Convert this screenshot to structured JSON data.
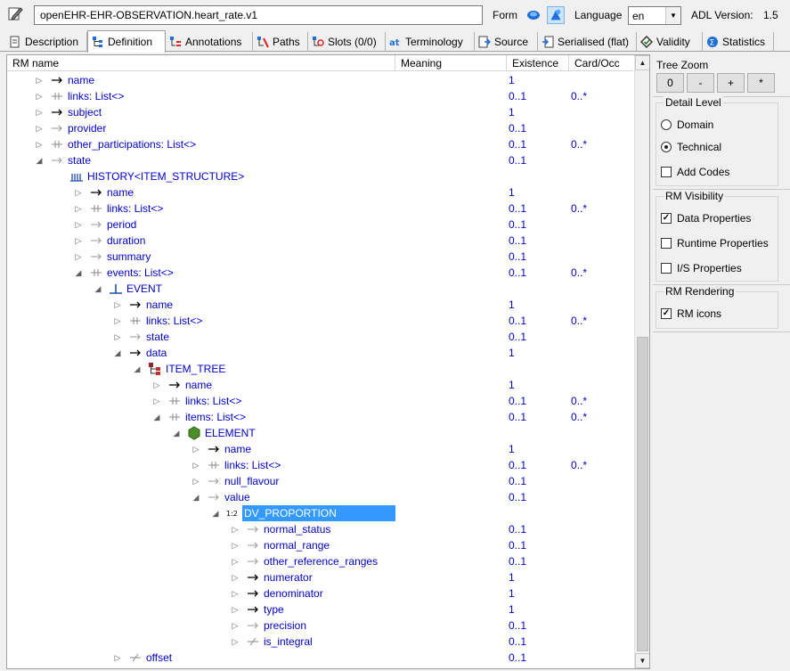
{
  "toolbar": {
    "archetype_id": "openEHR-EHR-OBSERVATION.heart_rate.v1",
    "form_label": "Form",
    "language_label": "Language",
    "language_value": "en",
    "adl_version_label": "ADL Version:",
    "adl_version_value": "1.5"
  },
  "tabs": [
    {
      "label": "Description",
      "icon": "description-icon",
      "active": false
    },
    {
      "label": "Definition",
      "icon": "definition-icon",
      "active": true
    },
    {
      "label": "Annotations",
      "icon": "annotations-icon",
      "active": false
    },
    {
      "label": "Paths",
      "icon": "paths-icon",
      "active": false
    },
    {
      "label": "Slots (0/0)",
      "icon": "slots-icon",
      "active": false
    },
    {
      "label": "Terminology",
      "icon": "terminology-icon",
      "active": false
    },
    {
      "label": "Source",
      "icon": "source-icon",
      "active": false
    },
    {
      "label": "Serialised (flat)",
      "icon": "serialised-icon",
      "active": false
    },
    {
      "label": "Validity",
      "icon": "validity-icon",
      "active": false
    },
    {
      "label": "Statistics",
      "icon": "statistics-icon",
      "active": false
    }
  ],
  "tree": {
    "columns": [
      "RM name",
      "Meaning",
      "Existence",
      "Card/Occ"
    ],
    "rows": [
      {
        "name": "name",
        "level": 0,
        "icon": "single-attr-icon",
        "toggle": "collapsed",
        "existence": "1",
        "card": ""
      },
      {
        "name": "links: List<>",
        "level": 0,
        "icon": "multi-attr-icon",
        "toggle": "collapsed",
        "existence": "0..1",
        "card": "0..*"
      },
      {
        "name": "subject",
        "level": 0,
        "icon": "single-attr-icon",
        "toggle": "collapsed",
        "existence": "1",
        "card": ""
      },
      {
        "name": "provider",
        "level": 0,
        "icon": "optional-attr-icon",
        "toggle": "collapsed",
        "existence": "0..1",
        "card": ""
      },
      {
        "name": "other_participations: List<>",
        "level": 0,
        "icon": "multi-attr-icon",
        "toggle": "collapsed",
        "existence": "0..1",
        "card": "0..*"
      },
      {
        "name": "state",
        "level": 0,
        "icon": "optional-attr-icon",
        "toggle": "expanded",
        "existence": "0..1",
        "card": ""
      },
      {
        "name": "HISTORY<ITEM_STRUCTURE>",
        "level": 1,
        "icon": "history-icon",
        "toggle": "none",
        "existence": "",
        "card": ""
      },
      {
        "name": "name",
        "level": 2,
        "icon": "single-attr-icon",
        "toggle": "collapsed",
        "existence": "1",
        "card": ""
      },
      {
        "name": "links: List<>",
        "level": 2,
        "icon": "multi-attr-icon",
        "toggle": "collapsed",
        "existence": "0..1",
        "card": "0..*"
      },
      {
        "name": "period",
        "level": 2,
        "icon": "optional-attr-icon",
        "toggle": "collapsed",
        "existence": "0..1",
        "card": ""
      },
      {
        "name": "duration",
        "level": 2,
        "icon": "optional-attr-icon",
        "toggle": "collapsed",
        "existence": "0..1",
        "card": ""
      },
      {
        "name": "summary",
        "level": 2,
        "icon": "optional-attr-icon",
        "toggle": "collapsed",
        "existence": "0..1",
        "card": ""
      },
      {
        "name": "events: List<>",
        "level": 2,
        "icon": "multi-attr-icon",
        "toggle": "expanded",
        "existence": "0..1",
        "card": "0..*"
      },
      {
        "name": "EVENT",
        "level": 3,
        "icon": "event-icon",
        "toggle": "expanded",
        "existence": "",
        "card": ""
      },
      {
        "name": "name",
        "level": 4,
        "icon": "single-attr-icon",
        "toggle": "collapsed",
        "existence": "1",
        "card": ""
      },
      {
        "name": "links: List<>",
        "level": 4,
        "icon": "multi-attr-icon",
        "toggle": "collapsed",
        "existence": "0..1",
        "card": "0..*"
      },
      {
        "name": "state",
        "level": 4,
        "icon": "optional-attr-icon",
        "toggle": "collapsed",
        "existence": "0..1",
        "card": ""
      },
      {
        "name": "data",
        "level": 4,
        "icon": "single-attr-icon",
        "toggle": "expanded",
        "existence": "1",
        "card": ""
      },
      {
        "name": "ITEM_TREE",
        "level": 5,
        "icon": "item-tree-icon",
        "toggle": "expanded",
        "existence": "",
        "card": ""
      },
      {
        "name": "name",
        "level": 6,
        "icon": "single-attr-icon",
        "toggle": "collapsed",
        "existence": "1",
        "card": ""
      },
      {
        "name": "links: List<>",
        "level": 6,
        "icon": "multi-attr-icon",
        "toggle": "collapsed",
        "existence": "0..1",
        "card": "0..*"
      },
      {
        "name": "items: List<>",
        "level": 6,
        "icon": "multi-attr-icon",
        "toggle": "expanded",
        "existence": "0..1",
        "card": "0..*"
      },
      {
        "name": "ELEMENT",
        "level": 7,
        "icon": "element-icon",
        "toggle": "expanded",
        "existence": "",
        "card": ""
      },
      {
        "name": "name",
        "level": 8,
        "icon": "single-attr-icon",
        "toggle": "collapsed",
        "existence": "1",
        "card": ""
      },
      {
        "name": "links: List<>",
        "level": 8,
        "icon": "multi-attr-icon",
        "toggle": "collapsed",
        "existence": "0..1",
        "card": "0..*"
      },
      {
        "name": "null_flavour",
        "level": 8,
        "icon": "optional-attr-icon",
        "toggle": "collapsed",
        "existence": "0..1",
        "card": ""
      },
      {
        "name": "value",
        "level": 8,
        "icon": "optional-attr-icon",
        "toggle": "expanded",
        "existence": "0..1",
        "card": ""
      },
      {
        "name": "DV_PROPORTION",
        "level": 9,
        "icon": "proportion-icon",
        "toggle": "expanded",
        "existence": "",
        "card": "",
        "selected": true
      },
      {
        "name": "normal_status",
        "level": 10,
        "icon": "optional-attr-icon",
        "toggle": "collapsed",
        "existence": "0..1",
        "card": ""
      },
      {
        "name": "normal_range",
        "level": 10,
        "icon": "optional-attr-icon",
        "toggle": "collapsed",
        "existence": "0..1",
        "card": ""
      },
      {
        "name": "other_reference_ranges",
        "level": 10,
        "icon": "optional-attr-icon",
        "toggle": "collapsed",
        "existence": "0..1",
        "card": ""
      },
      {
        "name": "numerator",
        "level": 10,
        "icon": "single-attr-icon",
        "toggle": "collapsed",
        "existence": "1",
        "card": ""
      },
      {
        "name": "denominator",
        "level": 10,
        "icon": "single-attr-icon",
        "toggle": "collapsed",
        "existence": "1",
        "card": ""
      },
      {
        "name": "type",
        "level": 10,
        "icon": "single-attr-icon",
        "toggle": "collapsed",
        "existence": "1",
        "card": ""
      },
      {
        "name": "precision",
        "level": 10,
        "icon": "optional-attr-icon",
        "toggle": "collapsed",
        "existence": "0..1",
        "card": ""
      },
      {
        "name": "is_integral",
        "level": 10,
        "icon": "computed-attr-icon",
        "toggle": "collapsed",
        "existence": "0..1",
        "card": ""
      },
      {
        "name": "offset",
        "level": 4,
        "icon": "computed-attr-icon",
        "toggle": "collapsed",
        "existence": "0..1",
        "card": ""
      }
    ]
  },
  "tree_zoom": {
    "title": "Tree Zoom",
    "buttons": [
      "0",
      "-",
      "+",
      "*"
    ]
  },
  "detail_level": {
    "title": "Detail Level",
    "options": [
      "Domain",
      "Technical"
    ],
    "selected": "Technical",
    "add_codes_label": "Add Codes",
    "add_codes_checked": false
  },
  "rm_visibility": {
    "title": "RM Visibility",
    "options": [
      {
        "label": "Data Properties",
        "checked": true
      },
      {
        "label": "Runtime Properties",
        "checked": false
      },
      {
        "label": "I/S Properties",
        "checked": false
      }
    ]
  },
  "rm_rendering": {
    "title": "RM Rendering",
    "options": [
      {
        "label": "RM icons",
        "checked": true
      }
    ]
  }
}
